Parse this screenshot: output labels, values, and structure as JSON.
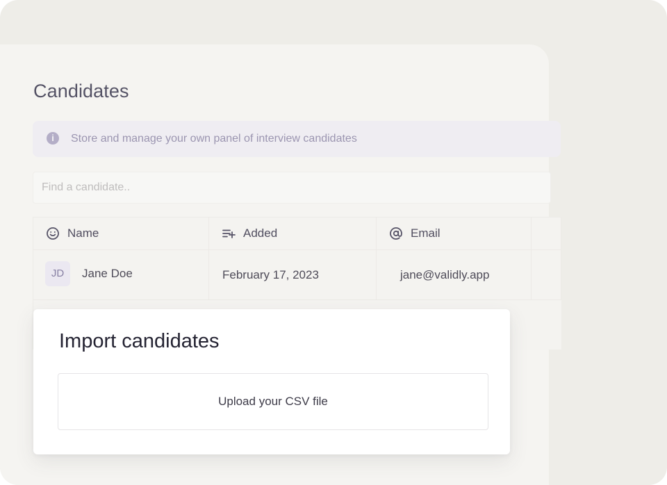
{
  "page": {
    "title": "Candidates",
    "info_text": "Store and manage your own panel of interview candidates"
  },
  "search": {
    "placeholder": "Find a candidate.."
  },
  "table": {
    "columns": [
      {
        "label": "Name",
        "icon": "smiley-icon"
      },
      {
        "label": "Added",
        "icon": "playlist-add-icon"
      },
      {
        "label": "Email",
        "icon": "at-sign-icon"
      }
    ],
    "rows": [
      {
        "initials": "JD",
        "name": "Jane Doe",
        "added": "February 17, 2023",
        "email": "jane@validly.app"
      }
    ]
  },
  "modal": {
    "title": "Import candidates",
    "upload_label": "Upload your CSV file"
  },
  "colors": {
    "background": "#eeede8",
    "panel": "#f5f4f1",
    "banner": "#efedf2",
    "accent": "#9b95b0",
    "text": "#4e4b58",
    "modal": "#ffffff"
  },
  "icons": {
    "info": "info-icon",
    "upload": "upload-button"
  }
}
